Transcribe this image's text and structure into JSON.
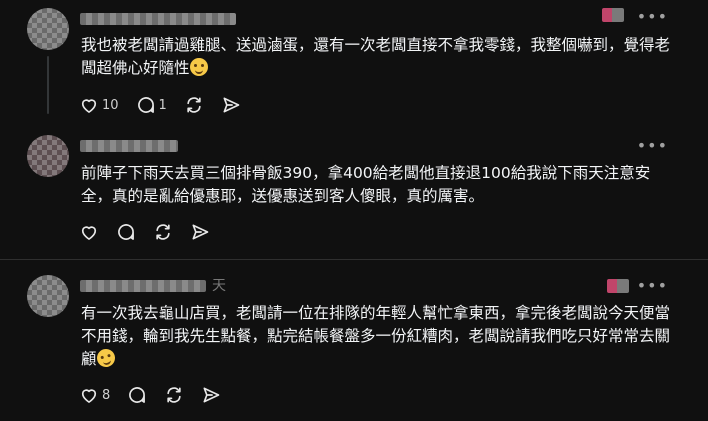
{
  "posts": [
    {
      "text": "我也被老闆請過雞腿、送過滷蛋，還有一次老闆直接不拿我零錢，我整個嚇到，覺得老闆超佛心好隨性",
      "emoji": "grimacing-face",
      "likes": "10",
      "replies": "1"
    },
    {
      "text": "前陣子下雨天去買三個排骨飯390，拿400給老闆他直接退100給我說下雨天注意安全，真的是亂給優惠耶，送優惠送到客人傻眼，真的厲害。"
    },
    {
      "username_suffix": "天",
      "text": "有一次我去龜山店買，老闆請一位在排隊的年輕人幫忙拿東西，拿完後老闆說今天便當不用錢，輪到我先生點餐，點完結帳餐盤多一份紅糟肉，老闆說請我們吃只好常常去關顧",
      "emoji": "rolling-laughing-face",
      "likes": "8"
    }
  ],
  "icons": {
    "like": "heart-icon",
    "reply": "comment-icon",
    "repost": "repost-icon",
    "share": "share-icon",
    "more": "more-options-icon"
  },
  "more_glyph": "•••"
}
